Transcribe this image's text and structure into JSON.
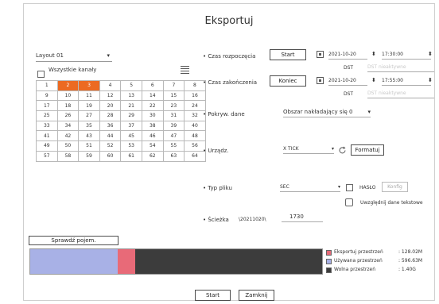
{
  "dialog": {
    "title": "Eksportuj"
  },
  "left": {
    "layout_select": "Layout 01",
    "all_channels_label": "Wszystkie kanały",
    "channels": [
      [
        "1",
        "2",
        "3",
        "4",
        "5",
        "6",
        "7",
        "8"
      ],
      [
        "9",
        "10",
        "11",
        "12",
        "13",
        "14",
        "15",
        "16"
      ],
      [
        "17",
        "18",
        "19",
        "20",
        "21",
        "22",
        "23",
        "24"
      ],
      [
        "25",
        "26",
        "27",
        "28",
        "29",
        "30",
        "31",
        "32"
      ],
      [
        "33",
        "34",
        "35",
        "36",
        "37",
        "38",
        "39",
        "40"
      ],
      [
        "41",
        "42",
        "43",
        "44",
        "45",
        "46",
        "47",
        "48"
      ],
      [
        "49",
        "50",
        "51",
        "52",
        "53",
        "54",
        "55",
        "56"
      ],
      [
        "57",
        "58",
        "59",
        "60",
        "61",
        "62",
        "63",
        "64"
      ]
    ],
    "selected_channels": [
      "2",
      "3"
    ],
    "selected_color": "#ec6a22"
  },
  "right": {
    "start_time_label": "• Czas rozpoczęcia",
    "start_button": "Start",
    "start_date": "2021-10-20",
    "start_time": "17:30:00",
    "dst_label": "DST",
    "dst_placeholder": "DST nieaktywne",
    "end_time_label": "• Czas zakończenia",
    "end_button": "Koniec",
    "end_date": "2021-10-20",
    "end_time": "17:55:00",
    "overlap_label": "• Pokryw. dane",
    "overlap_value": "Obszar nakładający się 0",
    "device_label": "• Urządz.",
    "device_value": "X TICK",
    "format_button": "Formatuj",
    "file_type_label": "• Typ pliku",
    "file_type_value": "SEC",
    "password_label": "HASŁO",
    "config_button": "Konfig",
    "text_data_label": "Uwzględnij dane tekstowe",
    "path_label": "• Ścieżka",
    "path_prefix": "\\20211020\\",
    "path_value": "1730"
  },
  "storage": {
    "check_button": "Sprawdź pojem.",
    "legend": [
      {
        "label": "Eksportuj przestrzeń",
        "value": ": 128.02M",
        "color": "#e86a78"
      },
      {
        "label": "Używana przestrzeń",
        "value": ": 596.63M",
        "color": "#a8b1e6"
      },
      {
        "label": "Wolna przestrzeń",
        "value": ": 1.40G",
        "color": "#3c3c3c"
      }
    ],
    "used_fraction": 0.3,
    "export_fraction": 0.06
  },
  "footer": {
    "start_button": "Start",
    "close_button": "Zamknij"
  }
}
